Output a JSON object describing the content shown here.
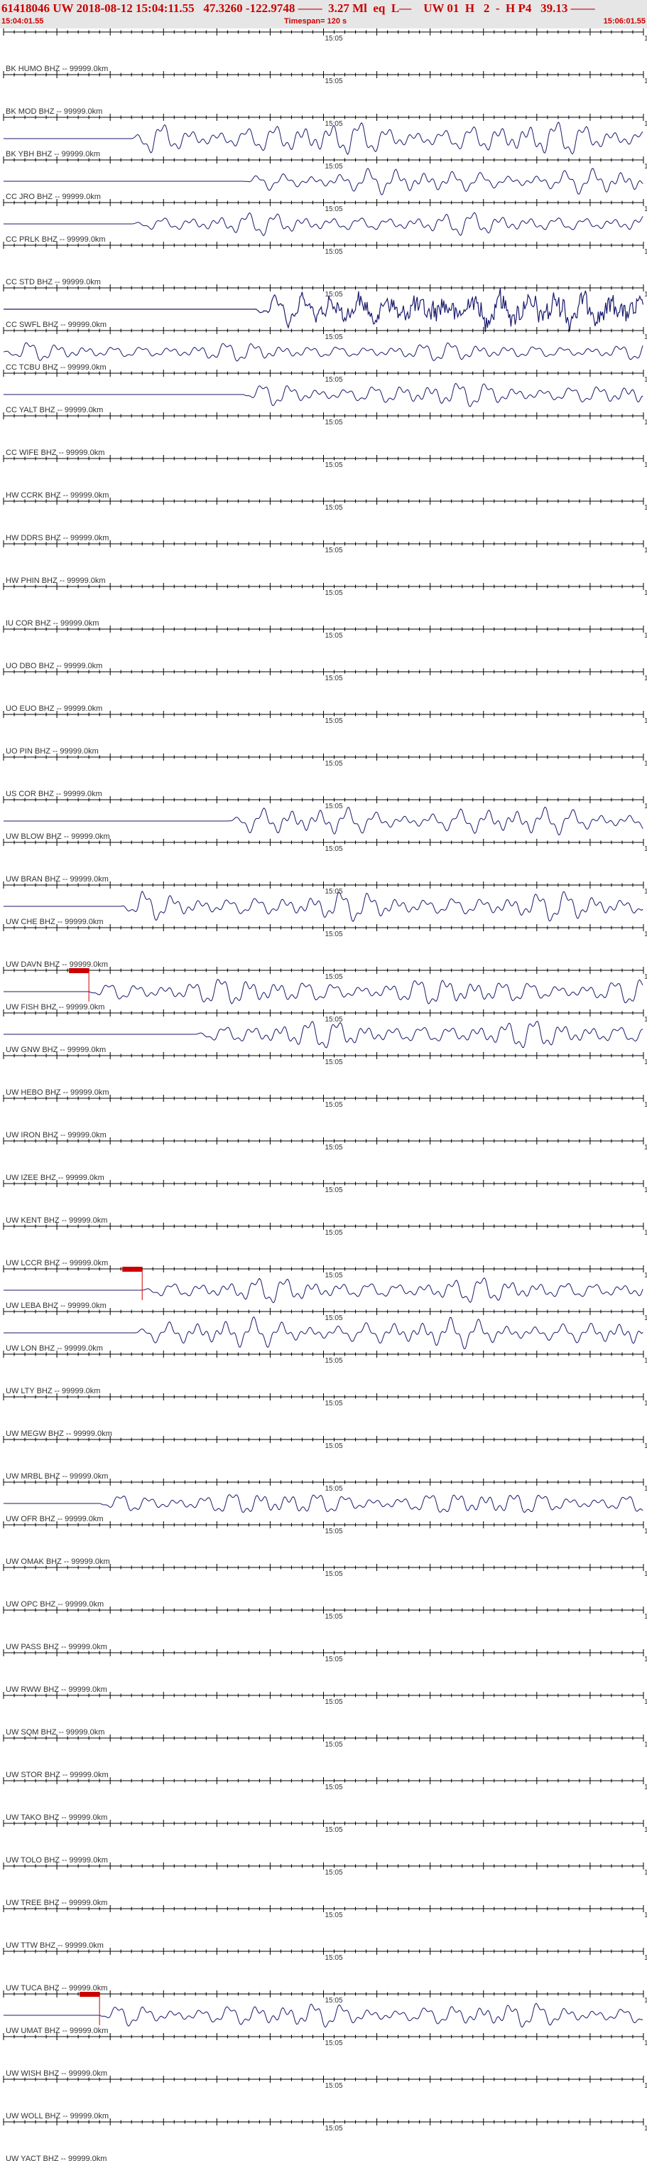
{
  "header": {
    "title": "61418046 UW 2018-08-12 15:04:11.55   47.3260 -122.9748 ——  3.27 Ml  eq  L—    UW 01  H   2  -  H P4   39.13 ——",
    "start_time": "15:04:01.55",
    "timespan": "Timespan= 120 s",
    "end_time": "15:06:01.55"
  },
  "colors": {
    "header_bg": "#e6e6e6",
    "header_text": "#cc0000",
    "trace": "#1a1a6e",
    "pick": "#cc0000",
    "axis": "#000000"
  },
  "chart_data": {
    "type": "line",
    "x_range_s": [
      0,
      120
    ],
    "mid_tick_label": "15:05",
    "right_label": "1",
    "stations": [
      {
        "label": "BK HUMO BHZ -- 99999.0km",
        "onset": null,
        "amp": 0,
        "active": false
      },
      {
        "label": "BK MOD BHZ -- 99999.0km",
        "onset": null,
        "amp": 0,
        "active": false
      },
      {
        "label": "BK YBH BHZ -- 99999.0km",
        "onset": 24,
        "amp": 22,
        "active": true
      },
      {
        "label": "CC JRO BHZ -- 99999.0km",
        "onset": 45,
        "amp": 16,
        "active": true
      },
      {
        "label": "CC PRLK BHZ -- 99999.0km",
        "onset": 24,
        "amp": 14,
        "active": true
      },
      {
        "label": "CC STD BHZ -- 99999.0km",
        "onset": null,
        "amp": 0,
        "active": false
      },
      {
        "label": "CC SWFL BHZ -- 99999.0km",
        "onset": 47,
        "amp": 20,
        "active": true,
        "noisy": true
      },
      {
        "label": "CC TCBU BHZ -- 99999.0km",
        "onset": 0,
        "amp": 12,
        "active": true
      },
      {
        "label": "CC YALT BHZ -- 99999.0km",
        "onset": 45,
        "amp": 16,
        "active": true
      },
      {
        "label": "CC WIFE BHZ -- 99999.0km",
        "onset": null,
        "amp": 0,
        "active": false
      },
      {
        "label": "HW CCRK BHZ -- 99999.0km",
        "onset": null,
        "amp": 0,
        "active": false
      },
      {
        "label": "HW DDRS BHZ -- 99999.0km",
        "onset": null,
        "amp": 0,
        "active": false
      },
      {
        "label": "HW PHIN BHZ -- 99999.0km",
        "onset": null,
        "amp": 0,
        "active": false
      },
      {
        "label": "IU COR BHZ -- 99999.0km",
        "onset": null,
        "amp": 0,
        "active": false
      },
      {
        "label": "UO DBO BHZ -- 99999.0km",
        "onset": null,
        "amp": 0,
        "active": false
      },
      {
        "label": "UO EUO BHZ -- 99999.0km",
        "onset": null,
        "amp": 0,
        "active": false
      },
      {
        "label": "UO PIN BHZ -- 99999.0km",
        "onset": null,
        "amp": 0,
        "active": false
      },
      {
        "label": "US COR BHZ -- 99999.0km",
        "onset": null,
        "amp": 0,
        "active": false
      },
      {
        "label": "UW BLOW BHZ -- 99999.0km",
        "onset": 42,
        "amp": 18,
        "active": true
      },
      {
        "label": "UW BRAN BHZ -- 99999.0km",
        "onset": null,
        "amp": 0,
        "active": false
      },
      {
        "label": "UW CHE BHZ -- 99999.0km",
        "onset": 22,
        "amp": 18,
        "active": true
      },
      {
        "label": "UW DAVN BHZ -- 99999.0km",
        "onset": null,
        "amp": 0,
        "active": false
      },
      {
        "label": "UW FISH BHZ -- 99999.0km",
        "onset": 16,
        "amp": 18,
        "active": true,
        "pick": 16
      },
      {
        "label": "UW GNW BHZ -- 99999.0km",
        "onset": 36,
        "amp": 18,
        "active": true
      },
      {
        "label": "UW HEBO BHZ -- 99999.0km",
        "onset": null,
        "amp": 0,
        "active": false
      },
      {
        "label": "UW IRON BHZ -- 99999.0km",
        "onset": null,
        "amp": 0,
        "active": false
      },
      {
        "label": "UW IZEE BHZ -- 99999.0km",
        "onset": null,
        "amp": 0,
        "active": false
      },
      {
        "label": "UW KENT BHZ -- 99999.0km",
        "onset": null,
        "amp": 0,
        "active": false
      },
      {
        "label": "UW LCCR BHZ -- 99999.0km",
        "onset": null,
        "amp": 0,
        "active": false
      },
      {
        "label": "UW LEBA BHZ -- 99999.0km",
        "onset": 26,
        "amp": 16,
        "active": true,
        "pick": 26
      },
      {
        "label": "UW LON BHZ -- 99999.0km",
        "onset": 24,
        "amp": 18,
        "active": true
      },
      {
        "label": "UW LTY BHZ -- 99999.0km",
        "onset": null,
        "amp": 0,
        "active": false
      },
      {
        "label": "UW MEGW BHZ -- 99999.0km",
        "onset": null,
        "amp": 0,
        "active": false
      },
      {
        "label": "UW MRBL BHZ -- 99999.0km",
        "onset": null,
        "amp": 0,
        "active": false
      },
      {
        "label": "UW OFR BHZ -- 99999.0km",
        "onset": 18,
        "amp": 16,
        "active": true
      },
      {
        "label": "UW OMAK BHZ -- 99999.0km",
        "onset": null,
        "amp": 0,
        "active": false
      },
      {
        "label": "UW OPC BHZ -- 99999.0km",
        "onset": null,
        "amp": 0,
        "active": false
      },
      {
        "label": "UW PASS BHZ -- 99999.0km",
        "onset": null,
        "amp": 0,
        "active": false
      },
      {
        "label": "UW RWW BHZ -- 99999.0km",
        "onset": null,
        "amp": 0,
        "active": false
      },
      {
        "label": "UW SQM BHZ -- 99999.0km",
        "onset": null,
        "amp": 0,
        "active": false
      },
      {
        "label": "UW STOR BHZ -- 99999.0km",
        "onset": null,
        "amp": 0,
        "active": false
      },
      {
        "label": "UW TAKO BHZ -- 99999.0km",
        "onset": null,
        "amp": 0,
        "active": false
      },
      {
        "label": "UW TOLO BHZ -- 99999.0km",
        "onset": null,
        "amp": 0,
        "active": false
      },
      {
        "label": "UW TREE BHZ -- 99999.0km",
        "onset": null,
        "amp": 0,
        "active": false
      },
      {
        "label": "UW TTW BHZ -- 99999.0km",
        "onset": null,
        "amp": 0,
        "active": false
      },
      {
        "label": "UW TUCA BHZ -- 99999.0km",
        "onset": null,
        "amp": 0,
        "active": false
      },
      {
        "label": "UW UMAT BHZ -- 99999.0km",
        "onset": 18,
        "amp": 16,
        "active": true,
        "pick": 18
      },
      {
        "label": "UW WISH BHZ -- 99999.0km",
        "onset": null,
        "amp": 0,
        "active": false
      },
      {
        "label": "UW WOLL BHZ -- 99999.0km",
        "onset": null,
        "amp": 0,
        "active": false
      },
      {
        "label": "UW YACT BHZ -- 99999.0km",
        "onset": null,
        "amp": 0,
        "active": false
      }
    ]
  }
}
